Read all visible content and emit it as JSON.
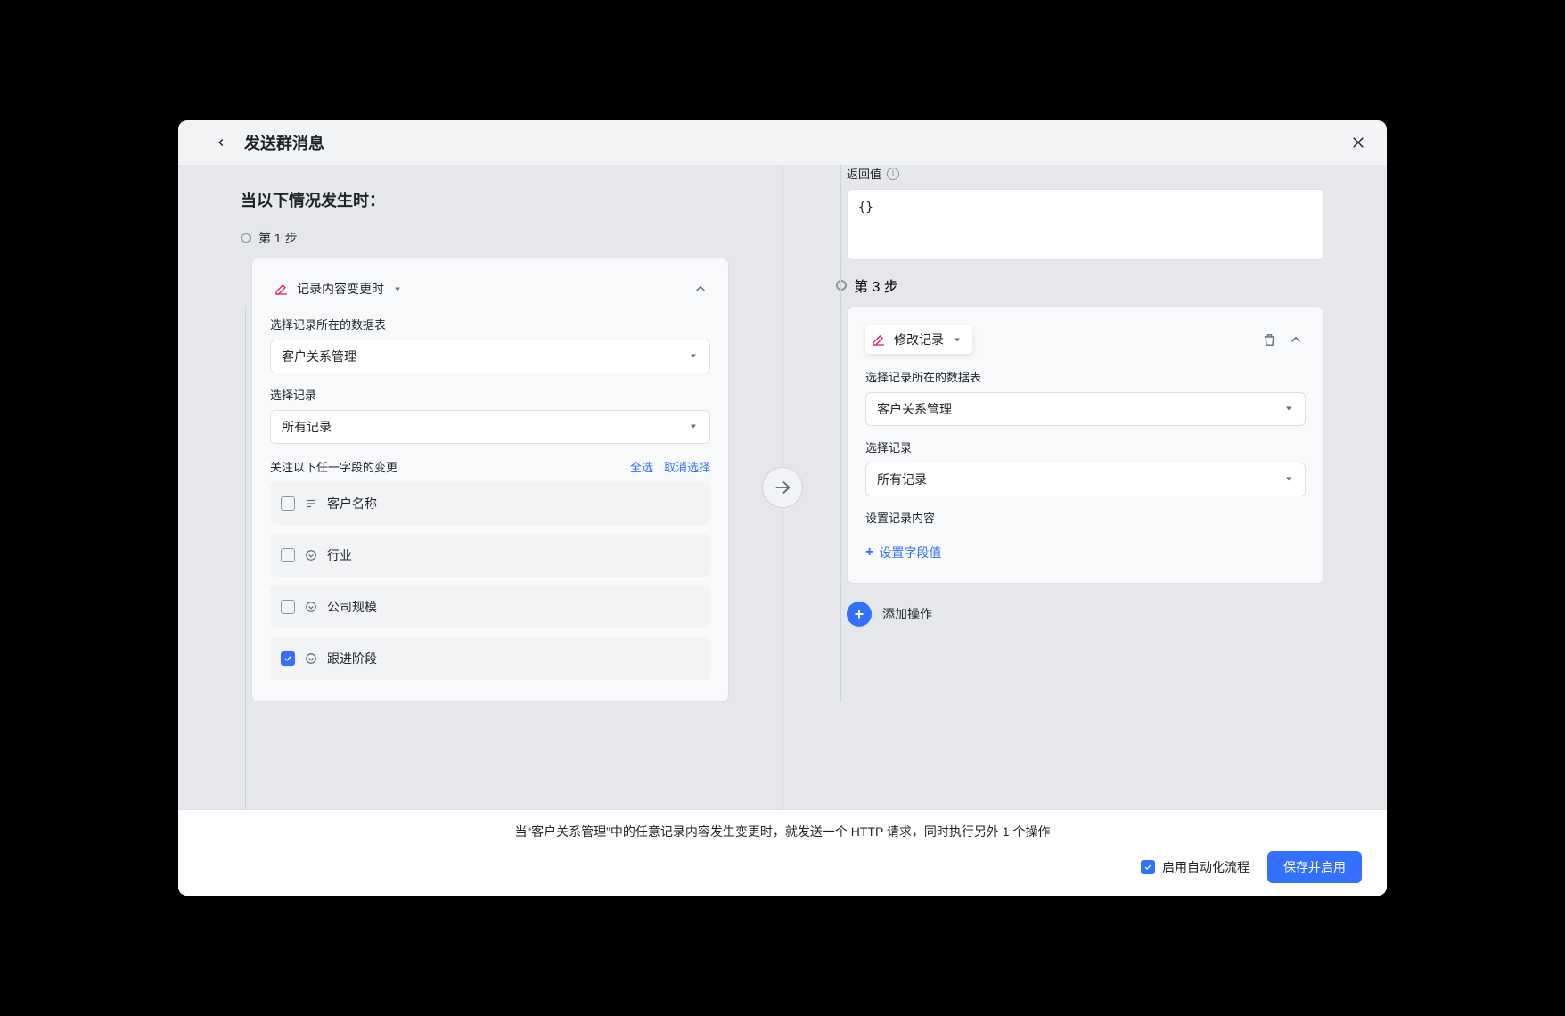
{
  "header": {
    "title": "发送群消息"
  },
  "left": {
    "section_heading": "当以下情况发生时：",
    "step1_label": "第 1 步",
    "trigger_label": "记录内容变更时",
    "table_label": "选择记录所在的数据表",
    "table_value": "客户关系管理",
    "record_label": "选择记录",
    "record_value": "所有记录",
    "watch_label": "关注以下任一字段的变更",
    "select_all": "全选",
    "deselect_all": "取消选择",
    "fields": [
      {
        "name": "客户名称",
        "type": "text",
        "checked": false
      },
      {
        "name": "行业",
        "type": "select",
        "checked": false
      },
      {
        "name": "公司规模",
        "type": "select",
        "checked": false
      },
      {
        "name": "跟进阶段",
        "type": "select",
        "checked": true
      }
    ]
  },
  "right": {
    "return_label": "返回值",
    "return_value": "{}",
    "step3_label": "第 3 步",
    "action_label": "修改记录",
    "table_label": "选择记录所在的数据表",
    "table_value": "客户关系管理",
    "record_label": "选择记录",
    "record_value": "所有记录",
    "set_content_label": "设置记录内容",
    "add_field_label": "设置字段值",
    "add_action_label": "添加操作"
  },
  "footer": {
    "summary": "当“客户关系管理”中的任意记录内容发生变更时，就发送一个 HTTP 请求，同时执行另外 1 个操作",
    "enable_label": "启用自动化流程",
    "save_btn": "保存并启用"
  }
}
